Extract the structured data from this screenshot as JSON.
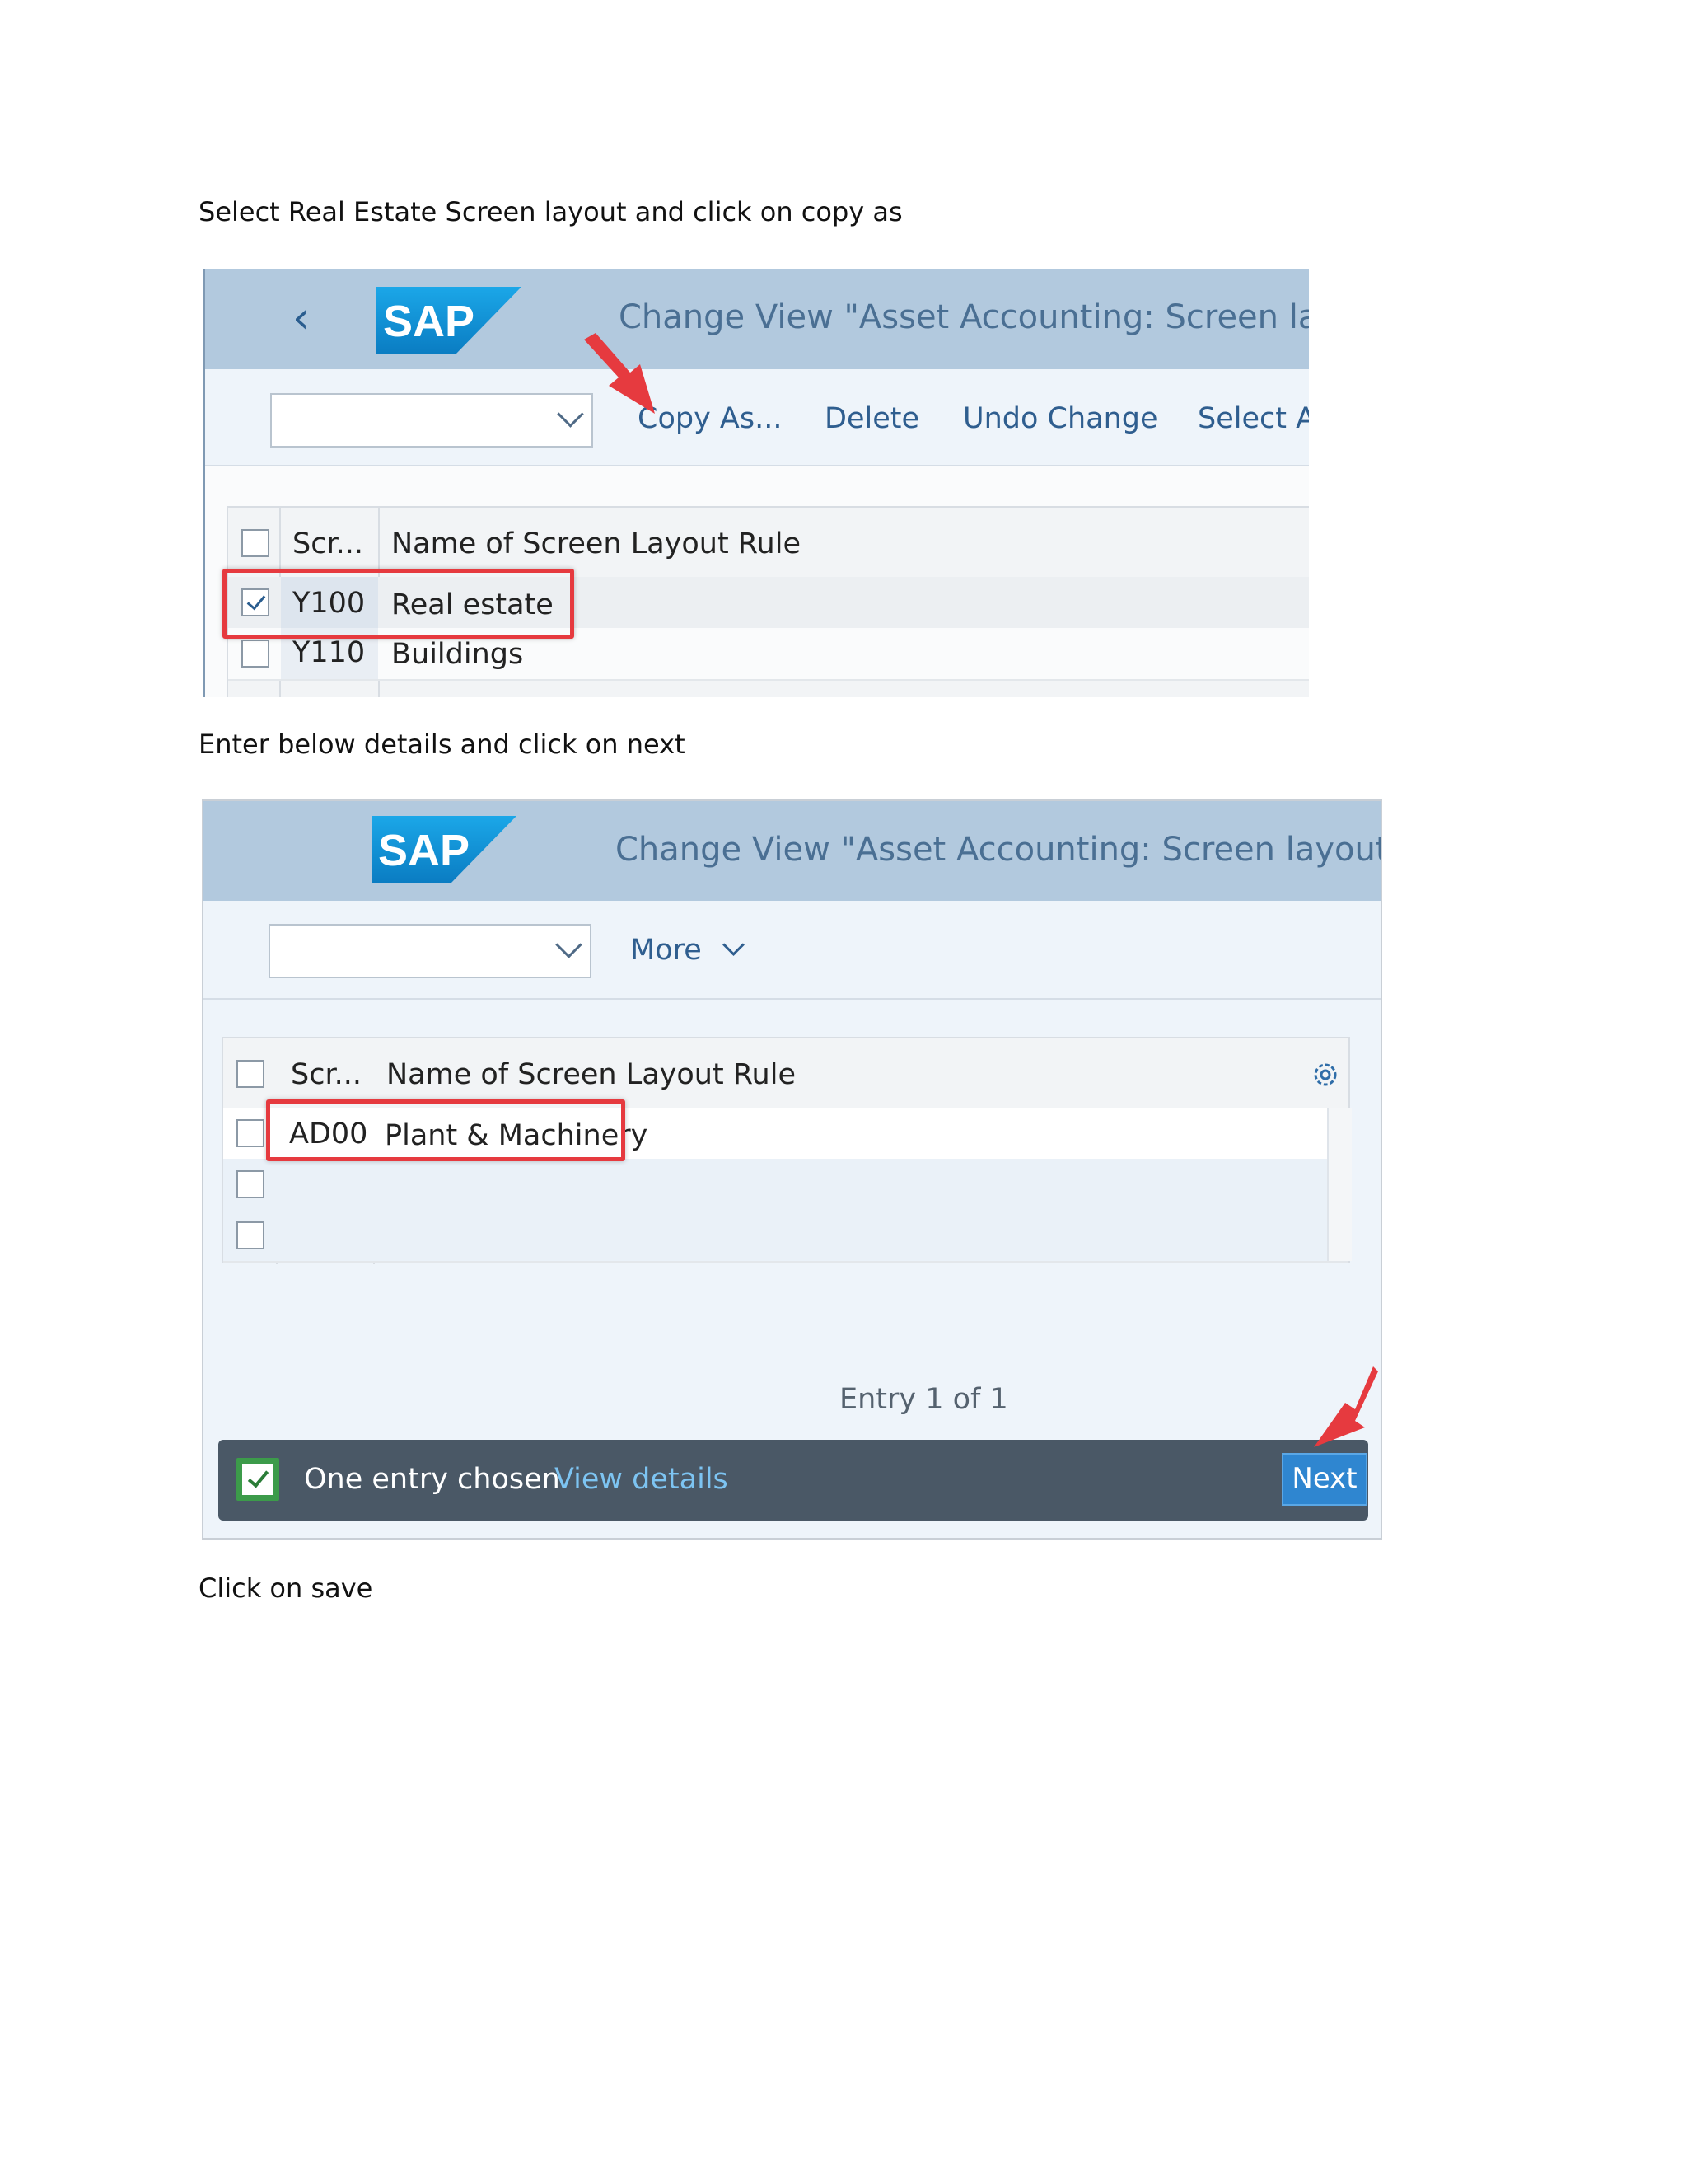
{
  "instructions": {
    "step1": "Select Real Estate Screen layout and click on copy as",
    "step2": "Enter below details and click on next",
    "step3": "Click on save"
  },
  "screen1": {
    "title": "Change View \"Asset Accounting: Screen layout f",
    "back_icon": "chevron-left-icon",
    "toolbar": {
      "copy_as": "Copy As...",
      "delete": "Delete",
      "undo_change": "Undo Change",
      "select_all": "Select Al"
    },
    "table": {
      "headers": [
        "Scr...",
        "Name of Screen Layout Rule"
      ],
      "rows": [
        {
          "code": "Y100",
          "name": "Real estate",
          "selected": true
        },
        {
          "code": "Y110",
          "name": "Buildings",
          "selected": false
        }
      ]
    }
  },
  "screen2": {
    "title": "Change View \"Asset Accounting: Screen layout for...",
    "toolbar": {
      "more": "More"
    },
    "table": {
      "headers": [
        "Scr...",
        "Name of Screen Layout Rule"
      ],
      "rows": [
        {
          "code": "AD00",
          "name": "Plant & Machinery"
        },
        {
          "code": "",
          "name": ""
        },
        {
          "code": "",
          "name": ""
        }
      ]
    },
    "entry_count": "Entry 1 of 1",
    "message": {
      "text": "One entry chosen",
      "link": "View details",
      "next": "Next"
    }
  },
  "colors": {
    "shellbar": "#b2c9de",
    "highlight": "#e63a3f",
    "sap_blue": "#1a9ad9",
    "footer": "#4a5866",
    "next_button": "#2f86d0"
  }
}
